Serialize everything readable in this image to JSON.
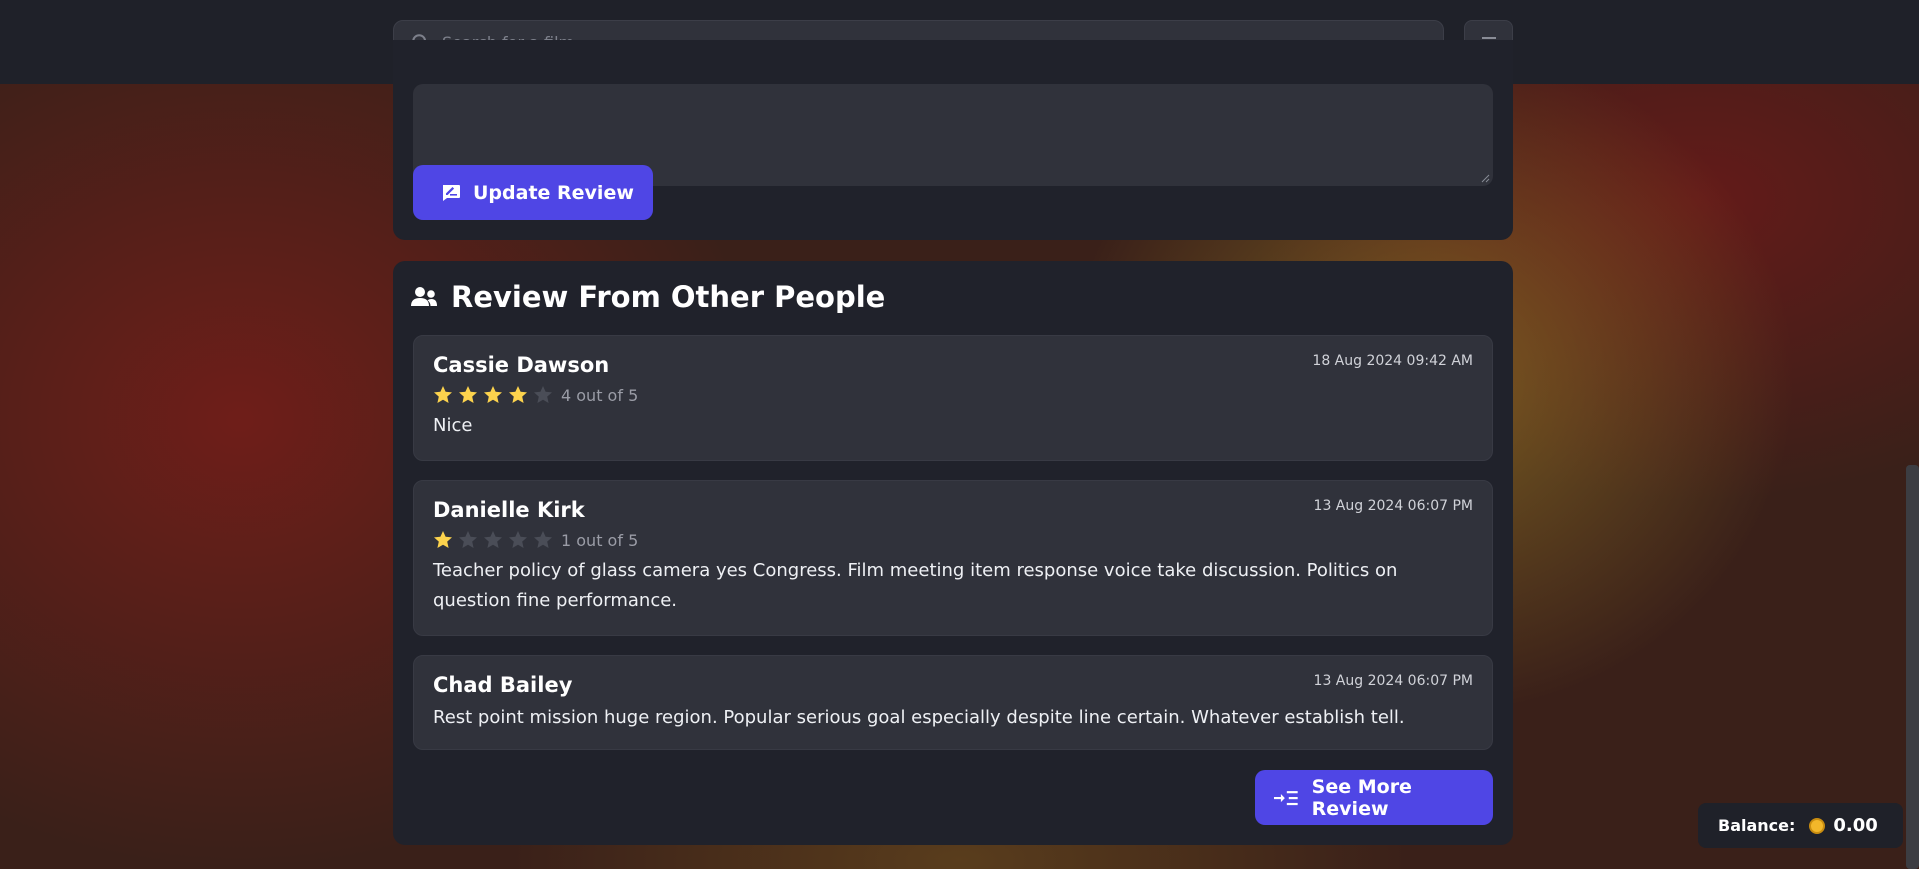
{
  "search": {
    "placeholder": "Search for a film"
  },
  "review_form": {
    "update_label": "Update Review"
  },
  "other_reviews": {
    "title": "Review From Other People",
    "items": [
      {
        "name": "Cassie Dawson",
        "date": "18 Aug 2024 09:42 AM",
        "rating": 4,
        "rating_label": "4 out of 5",
        "text": "Nice"
      },
      {
        "name": "Danielle Kirk",
        "date": "13 Aug 2024 06:07 PM",
        "rating": 1,
        "rating_label": "1 out of 5",
        "text": "Teacher policy of glass camera yes Congress. Film meeting item response voice take discussion. Politics on question fine performance."
      },
      {
        "name": "Chad Bailey",
        "date": "13 Aug 2024 06:07 PM",
        "text": "Rest point mission huge region. Popular serious goal especially despite line certain. Whatever establish tell."
      }
    ],
    "see_more_label": "See More Review"
  },
  "balance": {
    "label": "Balance:",
    "value": "0.00"
  },
  "colors": {
    "accent": "#4f46e5",
    "star_filled": "#fcd34d",
    "star_empty": "#4a4d57",
    "panel": "#20222b",
    "card": "#30323b"
  }
}
